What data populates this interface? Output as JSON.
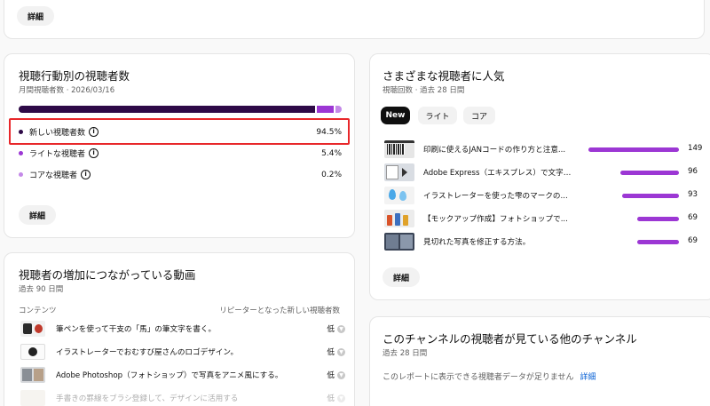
{
  "top_card": {
    "details_label": "詳細"
  },
  "behavior_card": {
    "title": "視聴行動別の視聴者数",
    "subtitle": "月間視聴者数 · 2026/03/16",
    "shares": {
      "new": 94.5,
      "light": 5.4,
      "core": 0.2
    },
    "rows": [
      {
        "label": "新しい視聴者数",
        "value": "94.5%",
        "color": "#2e0a47"
      },
      {
        "label": "ライトな視聴者",
        "value": "5.4%",
        "color": "#9c37d4"
      },
      {
        "label": "コアな視聴者",
        "value": "0.2%",
        "color": "#c489e8"
      }
    ],
    "details_label": "詳細",
    "highlight_color": "#e8272a"
  },
  "popular_card": {
    "title": "さまざまな視聴者に人気",
    "subtitle": "視聴回数 · 過去 28 日間",
    "tabs": [
      {
        "label": "New",
        "active": true
      },
      {
        "label": "ライト",
        "active": false
      },
      {
        "label": "コア",
        "active": false
      }
    ],
    "videos": [
      {
        "title": "印刷に使えるJANコードの作り方と注意...",
        "value": "149",
        "max_ratio": 1.0
      },
      {
        "title": "Adobe Express（エキスプレス）で文字を...",
        "value": "96",
        "max_ratio": 0.644
      },
      {
        "title": "イラストレーターを使った雫のマークの...",
        "value": "93",
        "max_ratio": 0.624
      },
      {
        "title": "【モックアップ作成】フォトショップで...",
        "value": "69",
        "max_ratio": 0.463
      },
      {
        "title": "見切れた写真を修正する方法。",
        "value": "69",
        "max_ratio": 0.463
      }
    ],
    "details_label": "詳細",
    "bar_color": "#9c37d4"
  },
  "growth_card": {
    "title": "視聴者の増加につながっている動画",
    "subtitle": "過去 90 日間",
    "col_content": "コンテンツ",
    "col_new": "リピーターとなった新しい視聴者数",
    "rows": [
      {
        "title": "筆ペンを使って干支の「馬」の筆文字を書く。",
        "value": "低"
      },
      {
        "title": "イラストレーターでおむすび屋さんのロゴデザイン。",
        "value": "低"
      },
      {
        "title": "Adobe Photoshop（フォトショップ）で写真をアニメ風にする。",
        "value": "低"
      },
      {
        "title": "手書きの罫線をブラシ登録して、デザインに活用する",
        "value": "低"
      }
    ]
  },
  "other_channels_card": {
    "title": "このチャンネルの視聴者が見ている他のチャンネル",
    "subtitle": "過去 28 日間",
    "message": "このレポートに表示できる視聴者データが足りません",
    "link_label": "詳細"
  }
}
